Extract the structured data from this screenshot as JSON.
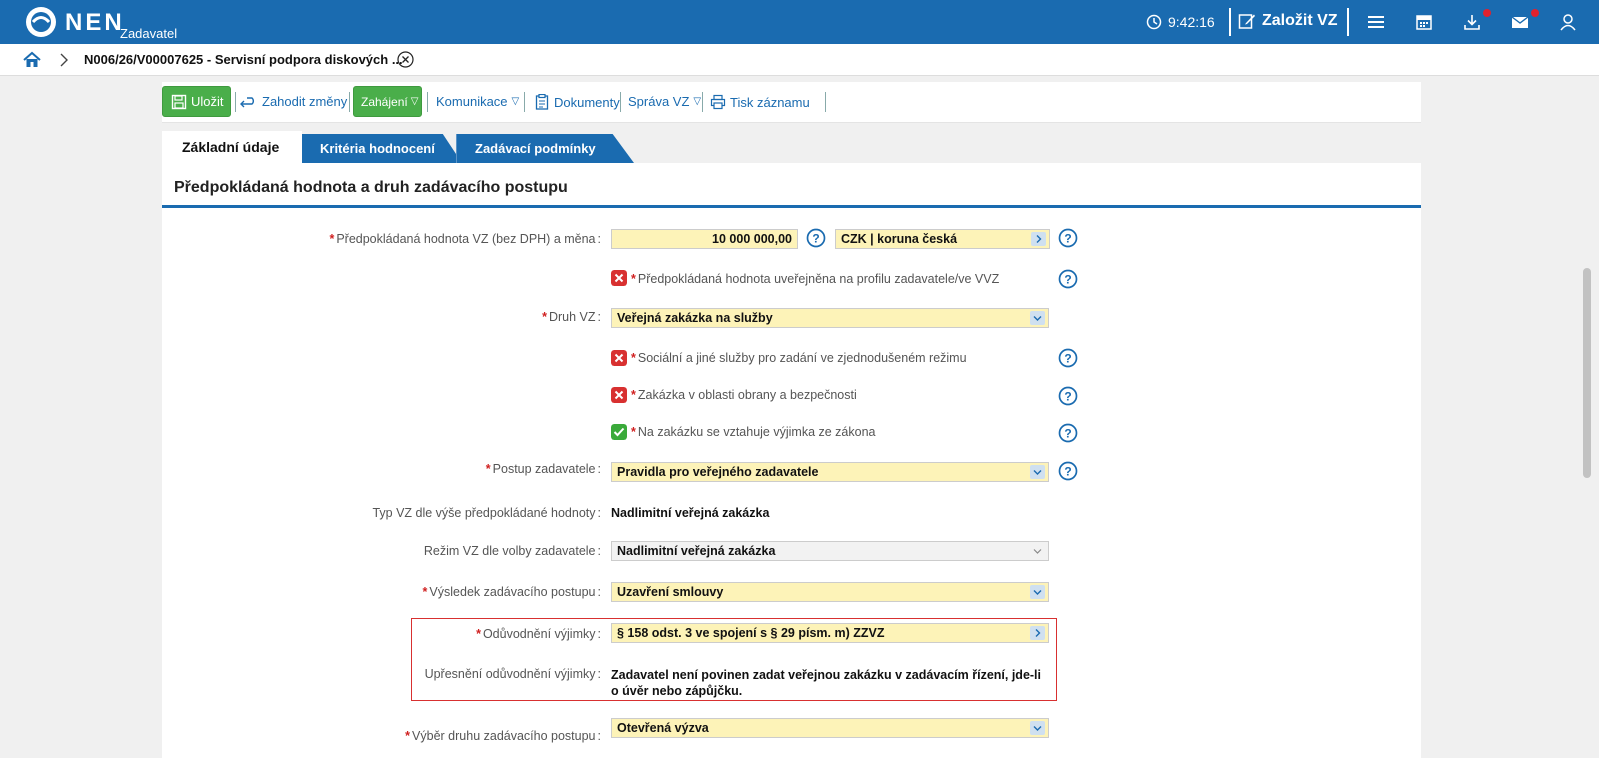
{
  "header": {
    "logo_text": "NEN",
    "logo_sub": "Zadavatel",
    "time": "9:42:16",
    "new_button": "Založit VZ",
    "icons": [
      "clock-icon",
      "edit-icon",
      "menu-icon",
      "calendar-icon",
      "download-icon",
      "mail-icon",
      "user-icon"
    ],
    "notification_color": "#e0222e"
  },
  "breadcrumb": {
    "title": "N006/26/V00007625 - Servisní podpora diskových ..."
  },
  "toolbar": {
    "save": "Uložit",
    "discard": "Zahodit změny",
    "start": "Zahájení",
    "communication": "Komunikace",
    "documents": "Dokumenty",
    "management": "Správa VZ",
    "print": "Tisk záznamu"
  },
  "tabs": [
    "Základní údaje",
    "Kritéria hodnocení",
    "Zadávací podmínky"
  ],
  "section": {
    "title": "Předpokládaná hodnota a druh zadávacího postupu"
  },
  "form": {
    "value_label": "Předpokládaná hodnota VZ (bez DPH) a měna",
    "value": "10 000 000,00",
    "currency": "CZK | koruna česká",
    "published_label": "Předpokládaná hodnota uveřejněna na profilu zadavatele/ve VVZ",
    "published_checked": false,
    "type_label": "Druh VZ",
    "type_value": "Veřejná zakázka na služby",
    "social_label": "Sociální a jiné služby pro zadání ve zjednodušeném režimu",
    "social_checked": false,
    "defense_label": "Zakázka v oblasti obrany a bezpečnosti",
    "defense_checked": false,
    "exception_label": "Na zakázku se vztahuje výjimka ze zákona",
    "exception_checked": true,
    "procedure_label": "Postup zadavatele",
    "procedure_value": "Pravidla pro veřejného zadavatele",
    "vz_type_label": "Typ VZ dle výše předpokládané hodnoty",
    "vz_type_value": "Nadlimitní veřejná zakázka",
    "regime_label": "Režim VZ dle volby zadavatele",
    "regime_value": "Nadlimitní veřejná zakázka",
    "result_label": "Výsledek zadávacího postupu",
    "result_value": "Uzavření smlouvy",
    "justification_label": "Odůvodnění výjimky",
    "justification_value": "§ 158 odst. 3 ve spojení s § 29 písm. m) ZZVZ",
    "clarification_label": "Upřesnění odůvodnění výjimky",
    "clarification_value": "Zadavatel není povinen zadat veřejnou zakázku v zadávacím řízení, jde-li o úvěr nebo zápůjčku.",
    "selection_label": "Výběr druhu zadávacího postupu",
    "selection_value": "Otevřená výzva"
  },
  "colors": {
    "brand": "#1a6bb0",
    "green": "#4aae4a",
    "required_field": "#fdf3b8",
    "error": "#d83030"
  }
}
